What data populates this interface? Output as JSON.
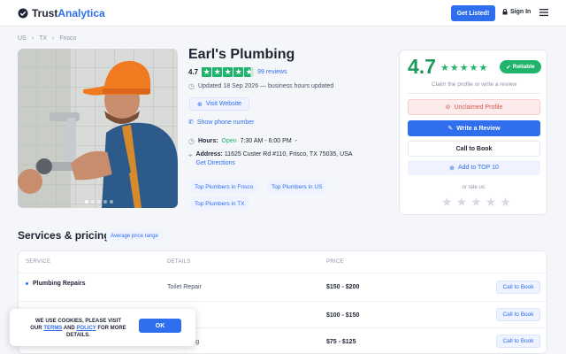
{
  "header": {
    "brand_a": "Trust",
    "brand_b": "Analytica",
    "cta": "Get Listed!",
    "signin": "Sign In"
  },
  "breadcrumbs": [
    "US",
    "TX",
    "Frisco"
  ],
  "business": {
    "name": "Earl's Plumbing",
    "rating": "4.7",
    "reviews": "99 reviews",
    "updated": "Updated 18 Sep 2026 — business hours updated",
    "visit": "Visit Website",
    "phone": "Show phone number",
    "hours_label": "Hours:",
    "hours_status": "Open",
    "hours_time": "7:30 AM - 6:00 PM",
    "hours_sep": "-",
    "address_label": "Address:",
    "address": "11625 Custer Rd #110, Frisco, TX 75035, USA",
    "directions": "Get Directions",
    "tags": [
      "Top Plumbers in Frisco",
      "Top Plumbers in US",
      "Top Plumbers in TX"
    ],
    "carousel_dots": 5,
    "carousel_active": 1
  },
  "card": {
    "rating": "4.7",
    "badge": "Reliable",
    "claim": "Claim the profile or write a review",
    "unclaimed": "Unclaimed Profile",
    "write": "Write a Review",
    "call": "Call to Book",
    "add_top": "Add to TOP 10",
    "or_rate": "or rate us:"
  },
  "services": {
    "title": "Services & pricing",
    "badge": "Average price range",
    "columns": [
      "SERVICE",
      "DETAILS",
      "PRICE"
    ],
    "rows": [
      {
        "service": "Plumbing Repairs",
        "detail": "Toilet Repair",
        "price": "$150 - $200",
        "action": "Call to Book"
      },
      {
        "service": "",
        "detail": "er",
        "price": "$100 - $150",
        "action": "Call to Book"
      },
      {
        "service": "",
        "detail": "gging",
        "price": "$75 - $125",
        "action": "Call to Book"
      }
    ]
  },
  "cookie": {
    "line1": "WE USE COOKIES, PLEASE VISIT",
    "our": "OUR",
    "terms": "TERMS",
    "and": "AND",
    "policy": "POLICY",
    "formore": "FOR MORE",
    "details": "DETAILS.",
    "ok": "OK"
  },
  "colors": {
    "accent": "#2f6fed",
    "green": "#1fb36b",
    "danger": "#d9534f"
  }
}
